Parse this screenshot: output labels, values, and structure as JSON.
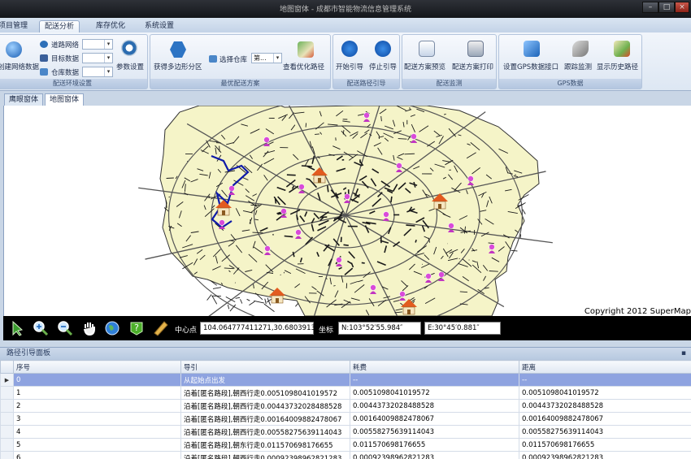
{
  "window": {
    "title": "地图窗体 - 成都市智能物流信息管理系统"
  },
  "window_buttons": [
    "–",
    "□",
    "×"
  ],
  "menu": {
    "tabs": [
      "项目管理",
      "配送分析",
      "库存优化",
      "系统设置"
    ],
    "active": 1
  },
  "ribbon": {
    "group1": {
      "label": "配送环境设置",
      "btn_build": "创建网络数据",
      "rows": [
        {
          "label": "道路网络",
          "value": ""
        },
        {
          "label": "目标数据",
          "value": ""
        },
        {
          "label": "仓库数据",
          "value": ""
        }
      ],
      "btn_params": "参数设置"
    },
    "group2": {
      "label": "最优配送方案",
      "btn_multi": "获得多边形分区",
      "warehouse_label": "选择仓库",
      "warehouse_value": "第...",
      "btn_view": "查看优化路径"
    },
    "group3": {
      "label": "配送路径引导",
      "btn_start": "开始引导",
      "btn_stop": "停止引导"
    },
    "group4": {
      "label": "配送监测",
      "btn_preview": "配送方案预览",
      "btn_print": "配送方案打印"
    },
    "group5": {
      "label": "GPS数据",
      "btn_gps": "设置GPS数据接口",
      "btn_track": "跟踪监测",
      "btn_history": "显示历史路径"
    }
  },
  "doc_tabs": [
    "鹰眼窗体",
    "地图窗体"
  ],
  "doc_tab_active": 1,
  "map": {
    "copyright": "Copyright 2012 SuperMap"
  },
  "toolbar": {
    "tools": [
      "select-arrow-icon",
      "zoom-in-icon",
      "zoom-out-icon",
      "pan-hand-icon",
      "globe-full-extent-icon",
      "help-query-icon",
      "measure-ruler-icon"
    ],
    "center_label": "中心点",
    "center_value": "104.064777411271,30.6803913",
    "coord_label": "坐标",
    "coord_n": "N:103°52′55.984″",
    "coord_e": "E:30°45′0.881″"
  },
  "panel": {
    "title": "路径引导面板",
    "columns": [
      "序号",
      "导引",
      "耗费",
      "距离"
    ],
    "rows": [
      {
        "no": "0",
        "guide": "从起始点出发",
        "cost": "--",
        "dist": "--",
        "selected": true
      },
      {
        "no": "1",
        "guide": "沿着[匿名路段],朝西行走0.0051098041019572",
        "cost": "0.0051098041019572",
        "dist": "0.0051098041019572"
      },
      {
        "no": "2",
        "guide": "沿着[匿名路段],朝西行走0.00443732028488528",
        "cost": "0.00443732028488528",
        "dist": "0.00443732028488528"
      },
      {
        "no": "3",
        "guide": "沿着[匿名路段],朝西行走0.00164009882478067",
        "cost": "0.00164009882478067",
        "dist": "0.00164009882478067"
      },
      {
        "no": "4",
        "guide": "沿着[匿名路段],朝西行走0.00558275639114043",
        "cost": "0.00558275639114043",
        "dist": "0.00558275639114043"
      },
      {
        "no": "5",
        "guide": "沿着[匿名路段],朝东行走0.011570698176655",
        "cost": "0.011570698176655",
        "dist": "0.011570698176655"
      },
      {
        "no": "6",
        "guide": "沿着[匿名路段],朝西行走0.00092398962821283",
        "cost": "0.00092398962821283",
        "dist": "0.00092398962821283"
      }
    ]
  }
}
